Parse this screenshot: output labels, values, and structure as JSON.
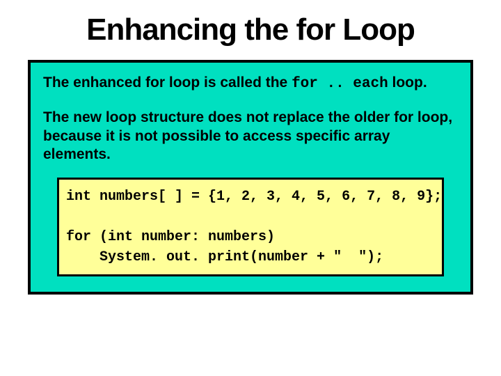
{
  "title": "Enhancing the for Loop",
  "para1_a": "The enhanced for loop is called the ",
  "para1_kw": "for .. each",
  "para1_b": " loop.",
  "para2": "The new loop structure does not replace the older for loop, because it is not possible to access specific array elements.",
  "code": "int numbers[ ] = {1, 2, 3, 4, 5, 6, 7, 8, 9};\n\nfor (int number: numbers)\n    System. out. print(number + \"  \");"
}
